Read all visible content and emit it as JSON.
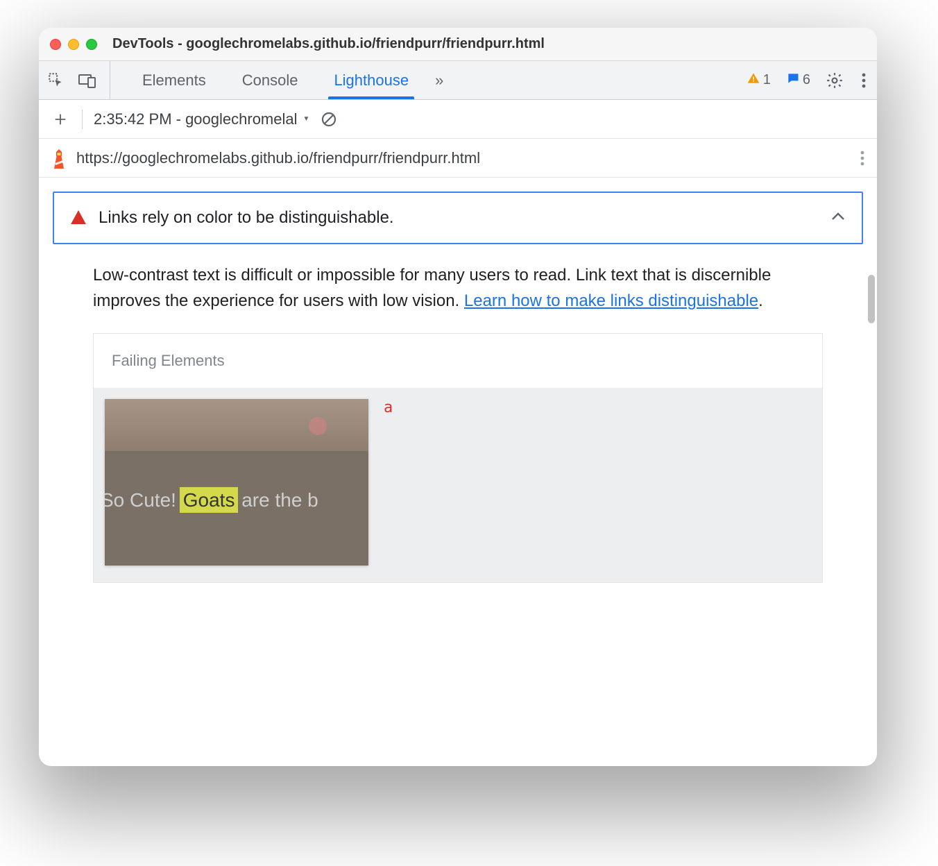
{
  "window": {
    "title": "DevTools - googlechromelabs.github.io/friendpurr/friendpurr.html"
  },
  "tabs": {
    "items": [
      "Elements",
      "Console",
      "Lighthouse"
    ],
    "active_index": 2,
    "overflow_glyph": "»"
  },
  "status": {
    "warnings": "1",
    "messages": "6"
  },
  "toolbar": {
    "timestamp": "2:35:42 PM - googlechromelal"
  },
  "urlbar": {
    "url": "https://googlechromelabs.github.io/friendpurr/friendpurr.html"
  },
  "audit": {
    "title": "Links rely on color to be distinguishable.",
    "description_pre": "Low-contrast text is difficult or impossible for many users to read. Link text that is discernible improves the experience for users with low vision. ",
    "learn_link": "Learn how to make links distinguishable",
    "description_post": "."
  },
  "failing": {
    "heading": "Failing Elements",
    "tag": "a",
    "thumb_text_pre": "So Cute! ",
    "thumb_text_hl": "Goats",
    "thumb_text_post": " are the b"
  }
}
